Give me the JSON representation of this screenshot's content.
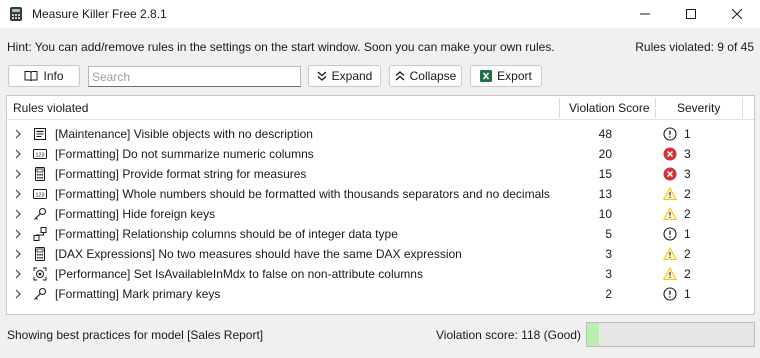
{
  "window": {
    "title": "Measure Killer Free 2.8.1"
  },
  "hint": {
    "text": "Hint: You can add/remove rules in the settings on the start window. Soon you can make your own rules.",
    "rules_violated": "Rules violated: 9 of 45"
  },
  "toolbar": {
    "info_label": "Info",
    "search_placeholder": "Search",
    "expand_label": "Expand",
    "collapse_label": "Collapse",
    "export_label": "Export"
  },
  "grid": {
    "columns": [
      "Rules violated",
      "Violation Score",
      "Severity"
    ],
    "rows": [
      {
        "icon": "description-icon",
        "label": "[Maintenance] Visible objects with no description",
        "score": "48",
        "severity_icon": "info-icon",
        "severity": "1"
      },
      {
        "icon": "numeric-column-icon",
        "label": "[Formatting] Do not summarize numeric columns",
        "score": "20",
        "severity_icon": "error-icon",
        "severity": "3"
      },
      {
        "icon": "calculator-icon",
        "label": "[Formatting] Provide format string for measures",
        "score": "15",
        "severity_icon": "error-icon",
        "severity": "3"
      },
      {
        "icon": "numeric-column-icon",
        "label": "[Formatting] Whole numbers should be formatted with thousands separators and no decimals",
        "score": "13",
        "severity_icon": "warning-icon",
        "severity": "2"
      },
      {
        "icon": "key-icon",
        "label": "[Formatting] Hide foreign keys",
        "score": "10",
        "severity_icon": "warning-icon",
        "severity": "2"
      },
      {
        "icon": "relationship-icon",
        "label": "[Formatting] Relationship columns should be of integer data type",
        "score": "5",
        "severity_icon": "info-icon",
        "severity": "1"
      },
      {
        "icon": "calculator-icon",
        "label": "[DAX Expressions] No two measures should have the same DAX expression",
        "score": "3",
        "severity_icon": "warning-icon",
        "severity": "2"
      },
      {
        "icon": "performance-icon",
        "label": "[Performance] Set IsAvailableInMdx to false on non-attribute columns",
        "score": "3",
        "severity_icon": "warning-icon",
        "severity": "2"
      },
      {
        "icon": "key-icon",
        "label": "[Formatting] Mark primary keys",
        "score": "2",
        "severity_icon": "info-icon",
        "severity": "1"
      }
    ]
  },
  "status": {
    "left": "Showing best practices for model [Sales Report]",
    "score_text": "Violation score: 118 (Good)",
    "score_fill_fraction": 0.07
  },
  "colors": {
    "error": "#d13438",
    "warning": "#f2c811",
    "score_good": "#b9f0b0",
    "export_green": "#1e7145"
  }
}
